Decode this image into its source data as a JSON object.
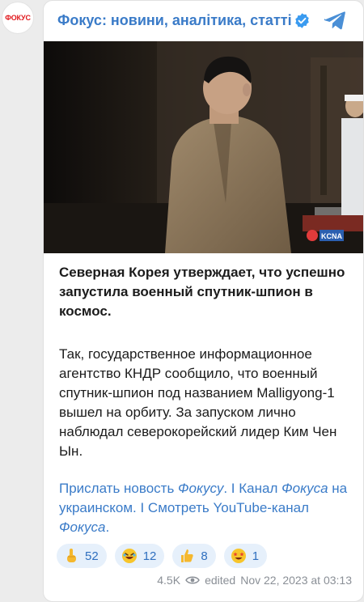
{
  "avatar": {
    "text": "ФОКУС"
  },
  "header": {
    "channel_title": "Фокус: новини, аналітика, статті",
    "verified_icon": "verified-badge-icon",
    "share_icon": "telegram-share-icon"
  },
  "photo": {
    "description_icon": "news-photo",
    "watermark": "KCNA"
  },
  "post": {
    "headline": "Северная Корея утверждает, что успешно запустила военный спутник-шпион в космос.",
    "body": "Так, государственное информационное агентство КНДР сообщило, что военный спутник-шпион под названием Malligyong-1 вышел на орбиту. За запуском лично наблюдал северокорейский лидер Ким Чен Ын.",
    "links": {
      "part1": "Прислать новость ",
      "part1_em": "Фокусу",
      "sep1": ". I ",
      "part2": "Канал ",
      "part2_em": "Фокуса",
      "part2_rest": " на украинском",
      "sep2": ". I ",
      "part3": "Смотреть YouTube-канал ",
      "part3_em": "Фокуса",
      "end": "."
    }
  },
  "reactions": [
    {
      "icon": "pointing-up-icon",
      "count": "52"
    },
    {
      "icon": "rofl-emoji-icon",
      "count": "12"
    },
    {
      "icon": "thumbs-up-icon",
      "count": "8"
    },
    {
      "icon": "star-struck-emoji-icon",
      "count": "1"
    }
  ],
  "footer": {
    "views": "4.5K",
    "status": "edited",
    "timestamp": "Nov 22, 2023 at 03:13"
  },
  "colors": {
    "accent": "#3a7bc8",
    "reaction_bg": "#e6f0fb",
    "brand_red": "#e1191d"
  }
}
